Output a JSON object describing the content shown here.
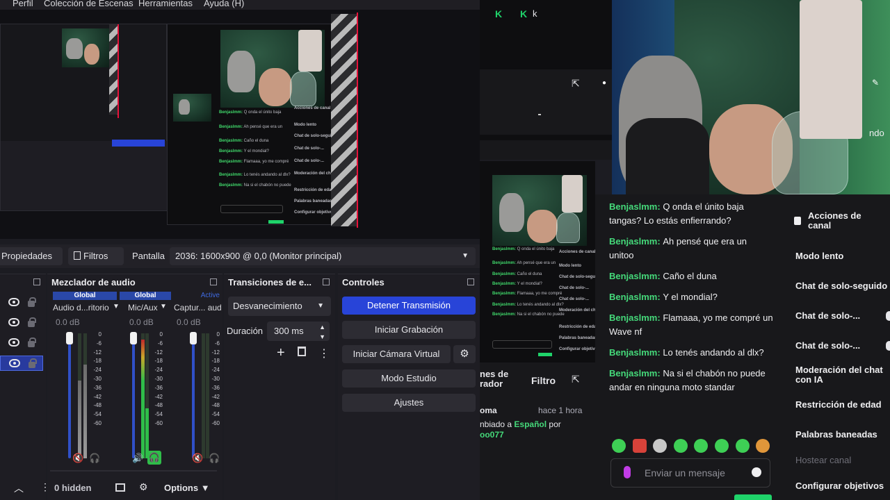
{
  "menu": {
    "items": [
      "Perfil",
      "Colección de Escenas",
      "Herramientas",
      "Ayuda (H)"
    ]
  },
  "properties_bar": {
    "properties_label": "Propiedades",
    "filters_label": "Filtros",
    "display_label": "Pantalla",
    "monitor_value": "2036: 1600x900 @ 0,0 (Monitor principal)"
  },
  "audio_mixer": {
    "title": "Mezclador de audio",
    "channels": [
      {
        "tag": "Global",
        "name": "Audio d...ritorio",
        "db": "0.0 dB"
      },
      {
        "tag": "Global",
        "name": "Mic/Aux",
        "db": "0.0 dB"
      },
      {
        "tag": "Active",
        "name": "Captur... aud",
        "db": "0.0 dB"
      }
    ],
    "ticks": [
      "0",
      "-6",
      "-12",
      "-18",
      "-24",
      "-30",
      "-36",
      "-42",
      "-48",
      "-54",
      "-60"
    ],
    "hidden_label": "0 hidden",
    "options_label": "Options"
  },
  "transitions": {
    "title": "Transiciones de e...",
    "selected": "Desvanecimiento",
    "duration_label": "Duración",
    "duration_value": "300 ms"
  },
  "controls": {
    "title": "Controles",
    "stop_stream": "Detener Transmisión",
    "start_recording": "Iniciar Grabación",
    "start_virtual_cam": "Iniciar Cámara Virtual",
    "studio_mode": "Modo Estudio",
    "settings": "Ajustes"
  },
  "twitch": {
    "header_letter": "k",
    "filter_label": "Filtro",
    "moderation_partial": "nes de\nrador",
    "activity_user_partial": "oma",
    "activity_time": "hace 1 hora",
    "activity_text_a": "nbiado a ",
    "activity_lang": "Español",
    "activity_text_b": " por",
    "activity_by": "oo077",
    "chat": [
      {
        "user": "Benjaslmm",
        "text": "Q onda el únito baja tangas? Lo estás enfierrando?"
      },
      {
        "user": "Benjaslmm",
        "text": "Ah pensé que era un unitoo"
      },
      {
        "user": "Benjaslmm",
        "text": "Caño el duna"
      },
      {
        "user": "Benjaslmm",
        "text": "Y el mondial?"
      },
      {
        "user": "Benjaslmm",
        "text": "Flamaaa, yo me compré un Wave nf"
      },
      {
        "user": "Benjaslmm",
        "text": "Lo tenés andando al dlx?"
      },
      {
        "user": "Benjaslmm",
        "text": "Na si el chabón no puede andar en ninguna moto standar"
      }
    ],
    "chat_placeholder": "Enviar un mensaje",
    "side_partial": "ndo",
    "actions": {
      "title": "Acciones de canal",
      "items": [
        "Modo lento",
        "Chat de solo-seguido",
        "Chat de solo-...",
        "Chat de solo-...",
        "Moderación del chat con IA",
        "Restricción de edad",
        "Palabras baneadas",
        "Hostear canal",
        "Configurar objetivos"
      ]
    }
  },
  "colors": {
    "accent_blue": "#2844d8",
    "twitch_green": "#45d97a",
    "live_red": "#e8123a"
  }
}
